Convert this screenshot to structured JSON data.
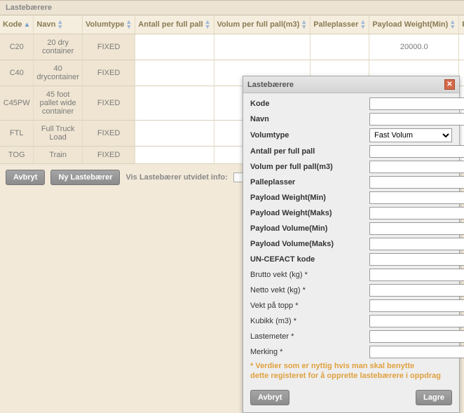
{
  "panel": {
    "title": "Lastebærere"
  },
  "columns": {
    "kode": "Kode",
    "navn": "Navn",
    "volumtype": "Volumtype",
    "antall": "Antall per full pall",
    "volum": "Volum per full pall(m3)",
    "palleplasser": "Palleplasser",
    "payloadMin": "Payload Weight(Min)",
    "payloadMax": "Paylo"
  },
  "rows": [
    {
      "kode": "C20",
      "navn": "20 dry container",
      "volumtype": "FIXED",
      "antall": "",
      "volum": "",
      "palleplasser": "",
      "payloadMin": "20000.0"
    },
    {
      "kode": "C40",
      "navn": "40 drycontainer",
      "volumtype": "FIXED",
      "antall": "",
      "volum": "",
      "palleplasser": "",
      "payloadMin": ""
    },
    {
      "kode": "C45PW",
      "navn": "45 foot pallet wide container",
      "volumtype": "FIXED",
      "antall": "",
      "volum": "",
      "palleplasser": "",
      "payloadMin": ""
    },
    {
      "kode": "FTL",
      "navn": "Full Truck Load",
      "volumtype": "FIXED",
      "antall": "",
      "volum": "",
      "palleplasser": "",
      "payloadMin": ""
    },
    {
      "kode": "TOG",
      "navn": "Train",
      "volumtype": "FIXED",
      "antall": "",
      "volum": "",
      "palleplasser": "",
      "payloadMin": ""
    }
  ],
  "toolbar": {
    "cancel": "Avbryt",
    "new": "Ny Lastebærer",
    "extended": "Vis Lastebærer utvidet info:"
  },
  "dialog": {
    "title": "Lastebærere",
    "fields": {
      "kode": "Kode",
      "navn": "Navn",
      "volumtype": "Volumtype",
      "antall": "Antall per full pall",
      "volum": "Volum per full pall(m3)",
      "palleplasser": "Palleplasser",
      "payloadWMin": "Payload Weight(Min)",
      "payloadWMax": "Payload Weight(Maks)",
      "payloadVMin": "Payload Volume(Min)",
      "payloadVMax": "Payload Volume(Maks)",
      "uncefact": "UN-CEFACT kode",
      "brutto": "Brutto vekt (kg) *",
      "netto": "Netto vekt (kg) *",
      "topp": "Vekt på topp *",
      "kubikk": "Kubikk (m3) *",
      "lastemeter": "Lastemeter *",
      "merking": "Merking *"
    },
    "volumtype_value": "Fast Volum",
    "note1": "* Verdier som er nyttig hvis man skal benytte",
    "note2": "dette registeret for å opprette lastebærere i oppdrag",
    "cancel": "Avbryt",
    "save": "Lagre"
  }
}
